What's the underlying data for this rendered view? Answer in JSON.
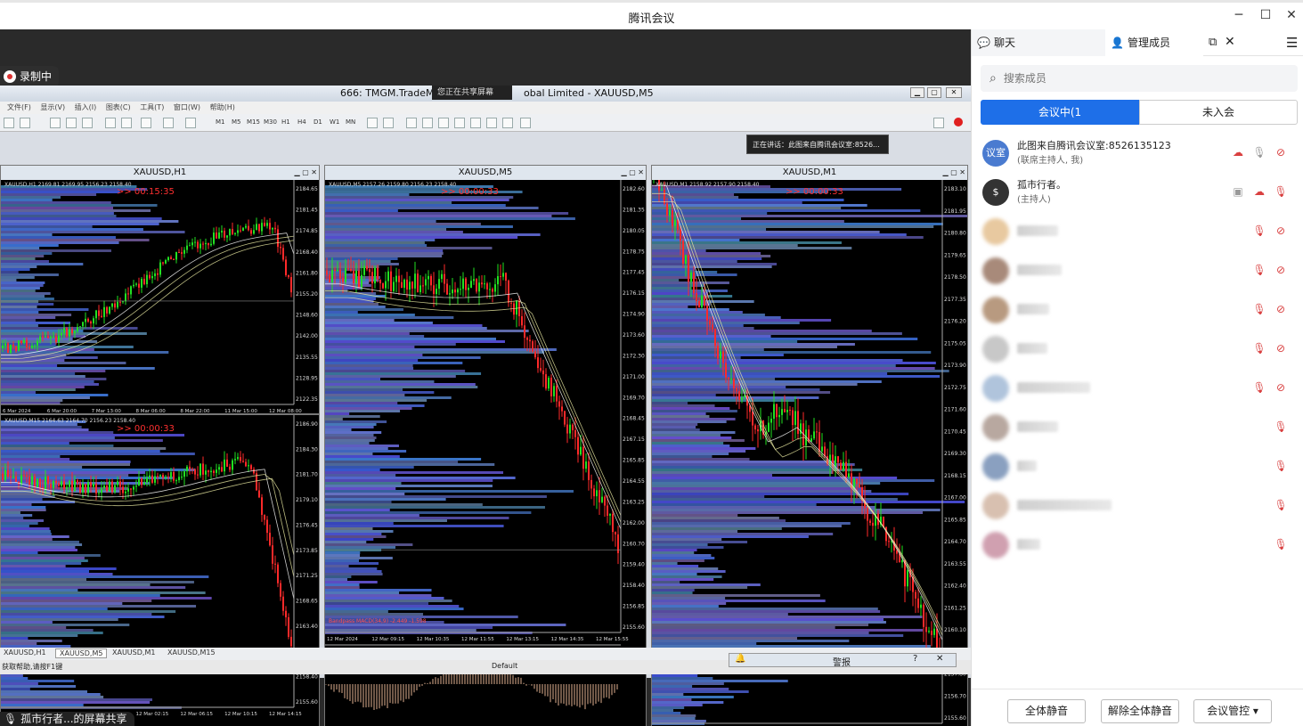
{
  "window": {
    "title": "腾讯会议",
    "minimize_icon": "─",
    "maximize_icon": "☐",
    "close_icon": "✕"
  },
  "share": {
    "recording_label": "录制中",
    "mt_title_left": "666: TMGM.TradeMa",
    "mt_title_right": "obal Limited - XAUUSD,M5",
    "sharing_badge": "您正在共享屏幕",
    "speaking_text": "正在讲话：此图来自腾讯会议室:8526...",
    "menu": [
      "文件(F)",
      "显示(V)",
      "插入(I)",
      "图表(C)",
      "工具(T)",
      "窗口(W)",
      "帮助(H)"
    ],
    "timeframes": [
      "M1",
      "M5",
      "M15",
      "M30",
      "H1",
      "H4",
      "D1",
      "W1",
      "MN"
    ],
    "charts": [
      {
        "title": "XAUUSD,H1",
        "ohlc": "XAUUSD,H1  2169.81 2169.95 2156.23 2158.40",
        "timer": ">> 00:15:35",
        "price_labels": [
          "2184.65",
          "2181.45",
          "2174.85",
          "2168.40",
          "2161.80",
          "2155.20",
          "2148.60",
          "2142.00",
          "2135.55",
          "2128.95",
          "2122.35"
        ],
        "time_labels": [
          "6 Mar 2024",
          "6 Mar 20:00",
          "7 Mar 13:00",
          "8 Mar 06:00",
          "8 Mar 22:00",
          "11 Mar 15:00",
          "12 Mar 08:00"
        ]
      },
      {
        "title": "XAUUSD,M15",
        "ohlc": "XAUUSD,M15  2164.63 2164.70 2156.23 2158.40",
        "timer": ">> 00:00:33",
        "price_labels": [
          "2186.90",
          "2184.30",
          "2181.70",
          "2179.10",
          "2176.45",
          "2173.85",
          "2171.25",
          "2168.65",
          "2163.40",
          "2160.80",
          "2158.40",
          "2155.60"
        ],
        "time_labels": [
          "11 Mar 2024",
          "11 Mar 12:15",
          "11 Mar 21:15",
          "12 Mar 02:15",
          "12 Mar 06:15",
          "12 Mar 10:15",
          "12 Mar 14:15"
        ]
      },
      {
        "title": "XAUUSD,M5",
        "ohlc": "XAUUSD,M5  2157.26 2159.80 2156.23 2158.40",
        "timer": ">> 00:00:33",
        "price_labels": [
          "2182.60",
          "2181.35",
          "2180.05",
          "2178.75",
          "2177.45",
          "2176.15",
          "2174.90",
          "2173.60",
          "2172.30",
          "2171.00",
          "2169.70",
          "2168.45",
          "2167.15",
          "2165.85",
          "2164.55",
          "2163.25",
          "2162.00",
          "2160.70",
          "2159.40",
          "2158.40",
          "2156.85",
          "2155.60"
        ],
        "time_labels": [
          "12 Mar 2024",
          "12 Mar 09:15",
          "12 Mar 10:35",
          "12 Mar 11:55",
          "12 Mar 13:15",
          "12 Mar 14:35",
          "12 Mar 15:55"
        ],
        "indicator": "Bandpass MACD(34,9) -2.449 -1.598"
      },
      {
        "title": "XAUUSD,M1",
        "ohlc": "XAUUSD,M1  2158.92 2157.90 2158.40",
        "timer": ">> 00:00:33",
        "price_labels": [
          "2183.10",
          "2181.95",
          "2180.80",
          "2179.65",
          "2178.50",
          "2177.35",
          "2176.20",
          "2175.05",
          "2173.90",
          "2172.75",
          "2171.60",
          "2170.45",
          "2169.30",
          "2168.15",
          "2167.00",
          "2165.85",
          "2164.70",
          "2163.55",
          "2162.40",
          "2161.25",
          "2160.10",
          "2158.95",
          "2157.80",
          "2156.70",
          "2155.60"
        ],
        "time_labels": [
          "12 Mar 2024",
          "12 Mar 15:17",
          "12 Mar 15:33",
          "12 Mar 15:49",
          "12 Mar 16:05",
          "12 Mar 16:21",
          "12 Mar 16:37"
        ]
      }
    ],
    "tabs": [
      "XAUUSD,H1",
      "XAUUSD,M5",
      "XAUUSD,M1",
      "XAUUSD,M15"
    ],
    "status_help": "获取帮助,请按F1键",
    "status_profile": "Default",
    "alarm_label": "警报",
    "presenter": "孤市行者...的屏幕共享"
  },
  "panel": {
    "tab_chat": "聊天",
    "tab_members": "管理成员",
    "search_placeholder": "搜索成员",
    "seg_in": "会议中(1",
    "seg_out": "未入会",
    "members": [
      {
        "avatar_text": "议室",
        "avatar_color": "#4a7bd0",
        "name": "此图来自腾讯会议室:8526135123",
        "role": "(联席主持人, 我)"
      },
      {
        "avatar_text": "$",
        "avatar_color": "#333333",
        "name": "孤市行者。",
        "role": "(主持人)"
      }
    ],
    "mute_all": "全体静音",
    "unmute_all": "解除全体静音",
    "meeting_control": "会议管控"
  }
}
